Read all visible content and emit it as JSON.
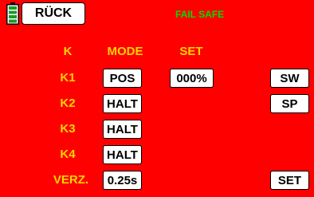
{
  "header": {
    "battery_icon": "battery-icon",
    "back_label": "RÜCK",
    "title": "FAIL SAFE"
  },
  "columns": {
    "k": "K",
    "mode": "MODE",
    "set": "SET"
  },
  "rows": [
    {
      "label": "K1",
      "mode": "POS",
      "set": "000%"
    },
    {
      "label": "K2",
      "mode": "HALT"
    },
    {
      "label": "K3",
      "mode": "HALT"
    },
    {
      "label": "K4",
      "mode": "HALT"
    }
  ],
  "delay": {
    "label": "VERZ.",
    "value": "0.25s"
  },
  "side_buttons": {
    "sw": "SW",
    "sp": "SP",
    "set": "SET"
  },
  "colors": {
    "background": "#ff0000",
    "labels": "#ffd400",
    "title": "#00dd00",
    "battery": "#1a9a2a"
  }
}
